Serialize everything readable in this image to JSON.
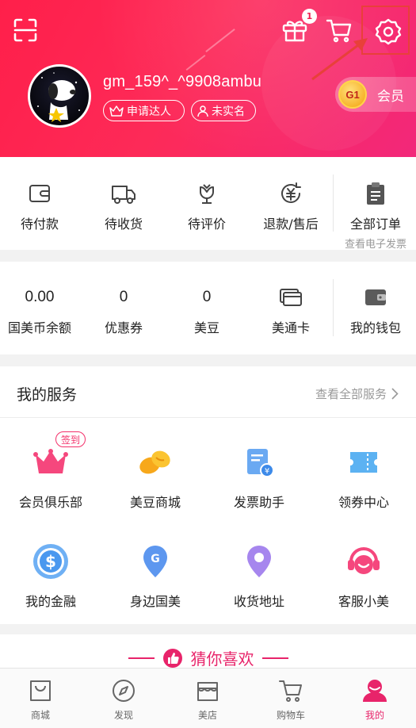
{
  "header": {
    "username": "gm_159^_^9908ambu",
    "gift_badge_count": "1",
    "tags": {
      "apply": "申请达人",
      "realname": "未实名"
    },
    "vip": {
      "level": "G1",
      "label": "会员"
    }
  },
  "orders": {
    "items": [
      {
        "label": "待付款",
        "icon": "wallet-icon"
      },
      {
        "label": "待收货",
        "icon": "truck-icon"
      },
      {
        "label": "待评价",
        "icon": "flower-icon"
      },
      {
        "label": "退款/售后",
        "icon": "refund-icon"
      }
    ],
    "all": {
      "label": "全部订单",
      "sub": "查看电子发票"
    }
  },
  "wallet": {
    "items": [
      {
        "value": "0.00",
        "label": "国美币余额"
      },
      {
        "value": "0",
        "label": "优惠券"
      },
      {
        "value": "0",
        "label": "美豆"
      }
    ],
    "card": {
      "label": "美通卡"
    },
    "my_wallet": {
      "label": "我的钱包"
    }
  },
  "services": {
    "title": "我的服务",
    "more": "查看全部服务",
    "signin_badge": "签到",
    "items": [
      {
        "label": "会员俱乐部",
        "icon": "crown-icon"
      },
      {
        "label": "美豆商城",
        "icon": "beans-icon"
      },
      {
        "label": "发票助手",
        "icon": "invoice-icon"
      },
      {
        "label": "领券中心",
        "icon": "coupon-icon"
      },
      {
        "label": "我的金融",
        "icon": "dollar-icon"
      },
      {
        "label": "身边国美",
        "icon": "location-g-icon"
      },
      {
        "label": "收货地址",
        "icon": "pin-icon"
      },
      {
        "label": "客服小美",
        "icon": "headset-icon"
      }
    ]
  },
  "guess": {
    "title": "猜你喜欢"
  },
  "tabbar": {
    "items": [
      {
        "label": "商城"
      },
      {
        "label": "发现"
      },
      {
        "label": "美店"
      },
      {
        "label": "购物车"
      },
      {
        "label": "我的"
      }
    ]
  },
  "colors": {
    "accent": "#e8246a",
    "header_start": "#ff1f4a",
    "header_end": "#f2287a"
  }
}
